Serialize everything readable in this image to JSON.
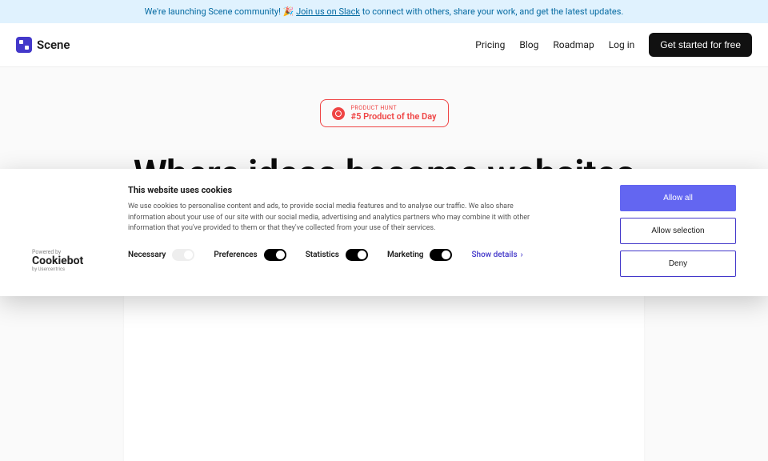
{
  "announcement": {
    "prefix": "We're launching Scene community! ",
    "link": "Join us on Slack",
    "suffix": " to connect with others, share your work, and get the latest updates."
  },
  "brand": "Scene",
  "nav": {
    "pricing": "Pricing",
    "blog": "Blog",
    "roadmap": "Roadmap",
    "login": "Log in",
    "cta": "Get started for free"
  },
  "producthunt": {
    "label": "PRODUCT HUNT",
    "title": "#5 Product of the Day"
  },
  "hero": {
    "title": "Where ideas become websites"
  },
  "cookie": {
    "powered_by": "Powered by",
    "provider": "Cookiebot",
    "provider_sub": "by Usercentrics",
    "title": "This website uses cookies",
    "description": "We use cookies to personalise content and ads, to provide social media features and to analyse our traffic. We also share information about your use of our site with our social media, advertising and analytics partners who may combine it with other information that you've provided to them or that they've collected from your use of their services.",
    "toggles": {
      "necessary": "Necessary",
      "preferences": "Preferences",
      "statistics": "Statistics",
      "marketing": "Marketing"
    },
    "show_details": "Show details",
    "buttons": {
      "allow_all": "Allow all",
      "allow_selection": "Allow selection",
      "deny": "Deny"
    }
  }
}
